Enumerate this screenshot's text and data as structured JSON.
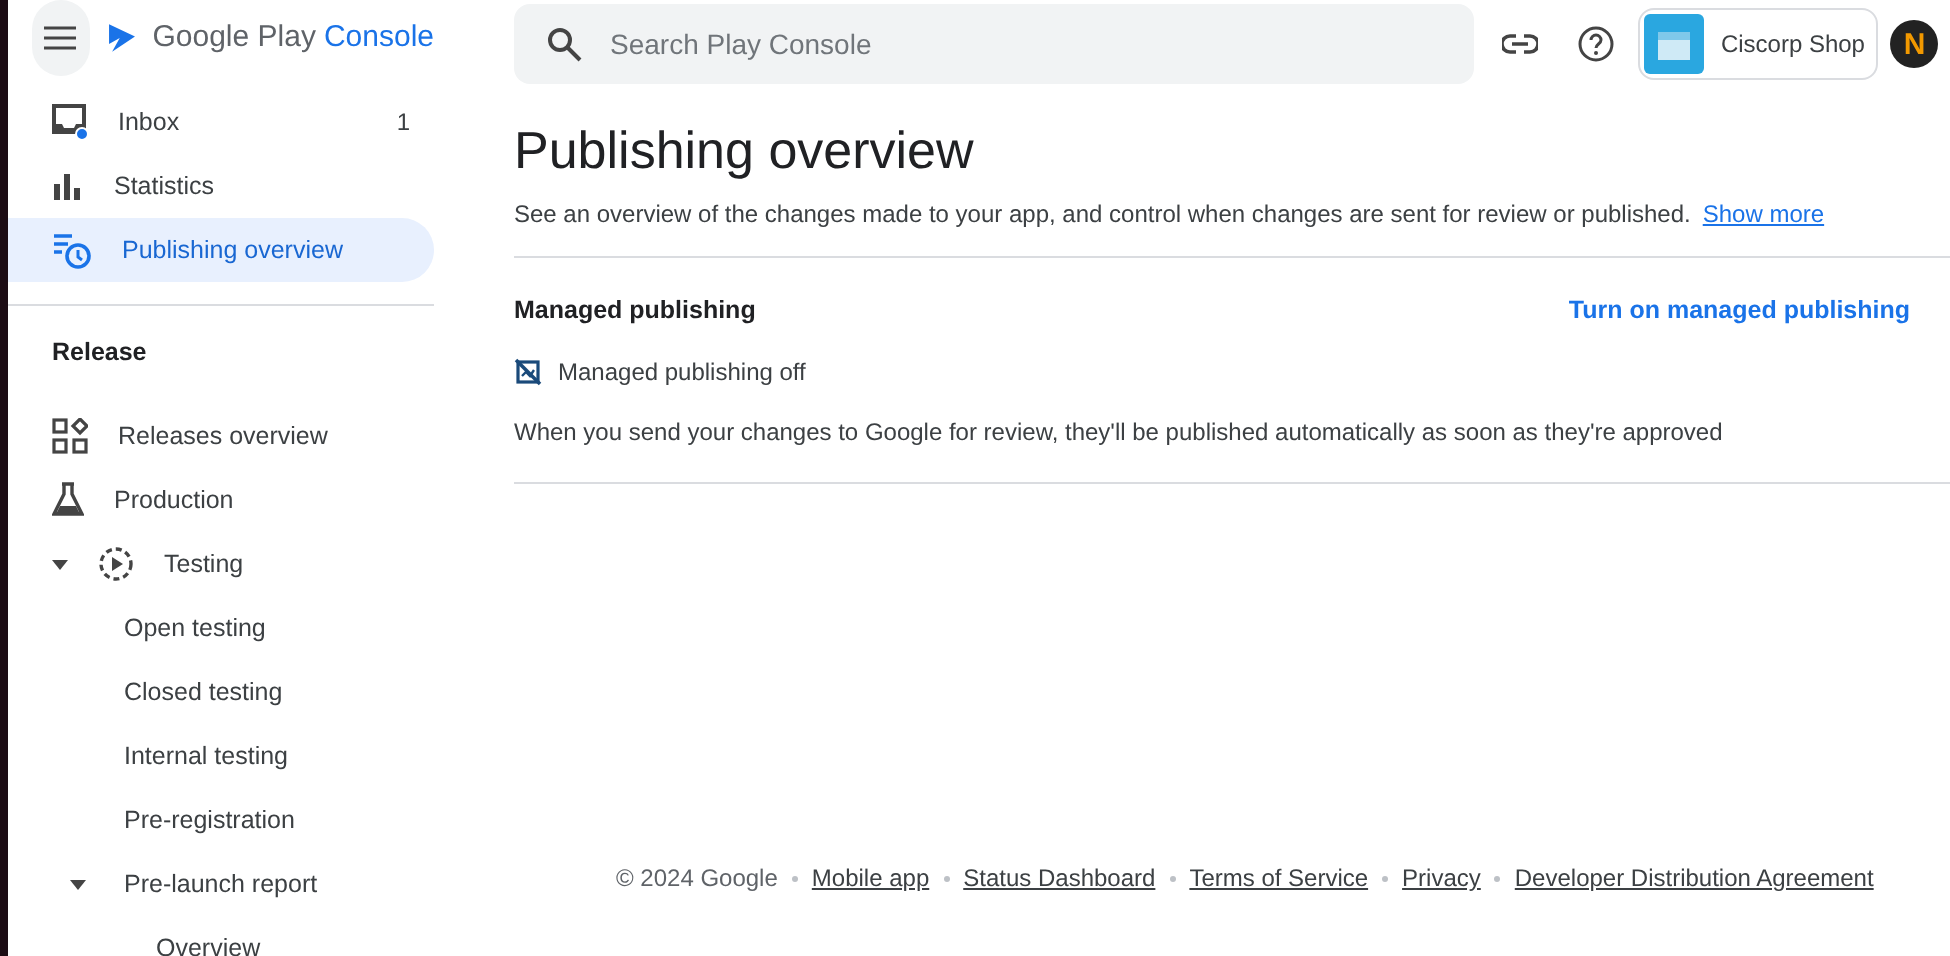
{
  "header": {
    "logo_text": "Google Play",
    "logo_accent": "Console",
    "search": {
      "placeholder": "Search Play Console"
    },
    "app_name": "Ciscorp Shop",
    "avatar_letter": "N"
  },
  "sidebar": {
    "items": [
      {
        "kind": "item",
        "label": "Inbox",
        "count": "1",
        "selected": false,
        "unread": true
      },
      {
        "kind": "item",
        "label": "Statistics",
        "selected": false
      },
      {
        "kind": "item",
        "label": "Publishing overview",
        "selected": true
      },
      {
        "kind": "divider"
      },
      {
        "kind": "section",
        "label": "Release"
      },
      {
        "kind": "item",
        "label": "Releases overview",
        "selected": false
      },
      {
        "kind": "item",
        "label": "Production",
        "selected": false
      },
      {
        "kind": "item",
        "label": "Testing",
        "selected": false,
        "expanded": true,
        "children": [
          {
            "label": "Open testing",
            "selected": false
          },
          {
            "label": "Closed testing",
            "selected": false
          },
          {
            "label": "Internal testing",
            "selected": false
          },
          {
            "label": "Pre-registration",
            "selected": false
          },
          {
            "label": "Pre-launch report",
            "selected": false,
            "expanded": true,
            "children": [
              {
                "label": "Overview",
                "selected": false
              }
            ]
          }
        ]
      }
    ]
  },
  "main": {
    "title": "Publishing overview",
    "description": "See an overview of the changes made to your app, and control when changes are sent for review or published.",
    "show_more": "Show more",
    "managed": {
      "heading": "Managed publishing",
      "action": "Turn on managed publishing",
      "on": false,
      "status": "Managed publishing off",
      "note": "When you send your changes to Google for review, they'll be published automatically as soon as they're approved"
    }
  },
  "footer": {
    "copyright": "© 2024 Google",
    "links": [
      "Mobile app",
      "Status Dashboard",
      "Terms of Service",
      "Privacy",
      "Developer Distribution Agreement"
    ]
  }
}
